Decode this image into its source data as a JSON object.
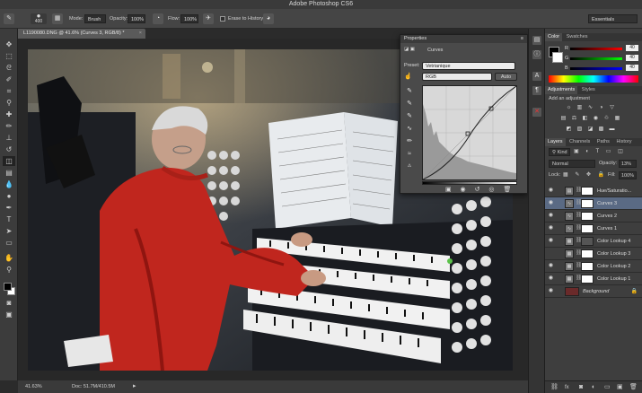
{
  "app": {
    "title": "Adobe Photoshop CS6"
  },
  "options_bar": {
    "mode_label": "Mode:",
    "mode_value": "Brush",
    "opacity_label": "Opacity:",
    "opacity_value": "100%",
    "flow_label": "Flow:",
    "flow_value": "100%",
    "erase_history_label": "Erase to History",
    "brush_size": "400",
    "workspace": "Essentials"
  },
  "document": {
    "tab_title": "L1190080.DNG @ 41.6% (Curves 3, RGB/8) *",
    "zoom": "41.63%",
    "doc_size": "Doc: 51.7M/410.5M"
  },
  "properties": {
    "header": "Properties",
    "panel_type": "Curves",
    "preset_label": "Preset:",
    "preset_value": "Vetrianique",
    "channel_value": "RGB",
    "auto_label": "Auto"
  },
  "color_panel": {
    "tabs": [
      "Color",
      "Swatches"
    ],
    "r_value": "40",
    "g_value": "40",
    "b_value": "40",
    "r_label": "R",
    "g_label": "G",
    "b_label": "B"
  },
  "adjustments_panel": {
    "tabs": [
      "Adjustments",
      "Styles"
    ],
    "add_label": "Add an adjustment"
  },
  "layers_panel": {
    "tabs": [
      "Layers",
      "Channels",
      "Paths",
      "History"
    ],
    "kind_label": "Kind",
    "blend_mode": "Normal",
    "opacity_label": "Opacity:",
    "opacity_value": "13%",
    "lock_label": "Lock:",
    "fill_label": "Fill:",
    "fill_value": "100%",
    "layers": [
      {
        "name": "Hue/Saturatio...",
        "visible": true,
        "selected": false
      },
      {
        "name": "Curves 3",
        "visible": true,
        "selected": true
      },
      {
        "name": "Curves 2",
        "visible": true,
        "selected": false
      },
      {
        "name": "Curves 1",
        "visible": true,
        "selected": false
      },
      {
        "name": "Color Lookup 4",
        "visible": true,
        "selected": false
      },
      {
        "name": "Color Lookup 3",
        "visible": false,
        "selected": false
      },
      {
        "name": "Color Lookup 2",
        "visible": true,
        "selected": false
      },
      {
        "name": "Color Lookup 1",
        "visible": true,
        "selected": false
      },
      {
        "name": "Background",
        "visible": true,
        "selected": false
      }
    ]
  },
  "colors": {
    "accent_selected": "#5a6a84",
    "fg": "#000000",
    "bg": "#ffffff"
  },
  "icons": {
    "home": "brush-preset-icon",
    "tools": [
      "move-icon",
      "marquee-icon",
      "lasso-icon",
      "quick-select-icon",
      "crop-icon",
      "eyedropper-icon",
      "healing-icon",
      "brush-icon",
      "clone-stamp-icon",
      "history-brush-icon",
      "eraser-icon",
      "gradient-icon",
      "blur-icon",
      "dodge-icon",
      "pen-icon",
      "type-icon",
      "path-select-icon",
      "shape-icon",
      "hand-icon",
      "zoom-icon"
    ]
  }
}
